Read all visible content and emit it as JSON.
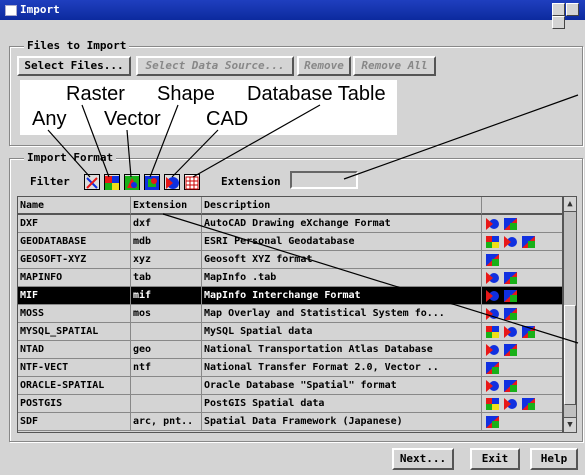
{
  "window": {
    "title": "Import"
  },
  "files_group": {
    "legend": "Files to Import",
    "buttons": {
      "select_files": "Select Files...",
      "select_source": "Select Data Source...",
      "remove": "Remove",
      "remove_all": "Remove All"
    }
  },
  "callout": {
    "any": "Any",
    "raster": "Raster",
    "vector": "Vector",
    "shape": "Shape",
    "cad": "CAD",
    "database_table": "Database Table"
  },
  "format_group": {
    "legend": "Import Format",
    "filter_label": "Filter",
    "extension_label": "Extension",
    "extension_value": ""
  },
  "table": {
    "headers": {
      "name": "Name",
      "extension": "Extension",
      "description": "Description"
    },
    "rows": [
      {
        "name": "DXF",
        "ext": "dxf",
        "desc": "AutoCAD Drawing eXchange Format",
        "icons": [
          "vector",
          "shape"
        ]
      },
      {
        "name": "GEODATABASE",
        "ext": "mdb",
        "desc": "ESRI Personal Geodatabase",
        "icons": [
          "raster",
          "vector",
          "shape"
        ]
      },
      {
        "name": "GEOSOFT-XYZ",
        "ext": "xyz",
        "desc": "Geosoft XYZ format",
        "icons": [
          "shape"
        ]
      },
      {
        "name": "MAPINFO",
        "ext": "tab",
        "desc": "MapInfo .tab",
        "icons": [
          "vector",
          "shape"
        ]
      },
      {
        "name": "MIF",
        "ext": "mif",
        "desc": "MapInfo Interchange Format",
        "icons": [
          "vector",
          "shape"
        ],
        "selected": true
      },
      {
        "name": "MOSS",
        "ext": "mos",
        "desc": "Map Overlay and Statistical System fo...",
        "icons": [
          "vector",
          "shape"
        ]
      },
      {
        "name": "MYSQL_SPATIAL",
        "ext": "",
        "desc": "MySQL Spatial data",
        "icons": [
          "raster",
          "vector",
          "shape"
        ]
      },
      {
        "name": "NTAD",
        "ext": "geo",
        "desc": "National Transportation Atlas Database",
        "icons": [
          "vector",
          "shape"
        ]
      },
      {
        "name": "NTF-VECT",
        "ext": "ntf",
        "desc": "National Transfer Format 2.0, Vector ..",
        "icons": [
          "shape"
        ]
      },
      {
        "name": "ORACLE-SPATIAL",
        "ext": "",
        "desc": "Oracle Database \"Spatial\" format",
        "icons": [
          "vector",
          "shape"
        ]
      },
      {
        "name": "POSTGIS",
        "ext": "",
        "desc": "PostGIS Spatial data",
        "icons": [
          "raster",
          "vector",
          "shape"
        ]
      },
      {
        "name": "SDF",
        "ext": "arc, pnt..",
        "desc": "Spatial Data Framework (Japanese)",
        "icons": [
          "shape"
        ]
      }
    ]
  },
  "footer": {
    "next": "Next...",
    "exit": "Exit",
    "help": "Help"
  },
  "icon_colors": {
    "red": "#e81818",
    "blue": "#1030e0",
    "green": "#18b018",
    "yellow": "#f0e018"
  }
}
